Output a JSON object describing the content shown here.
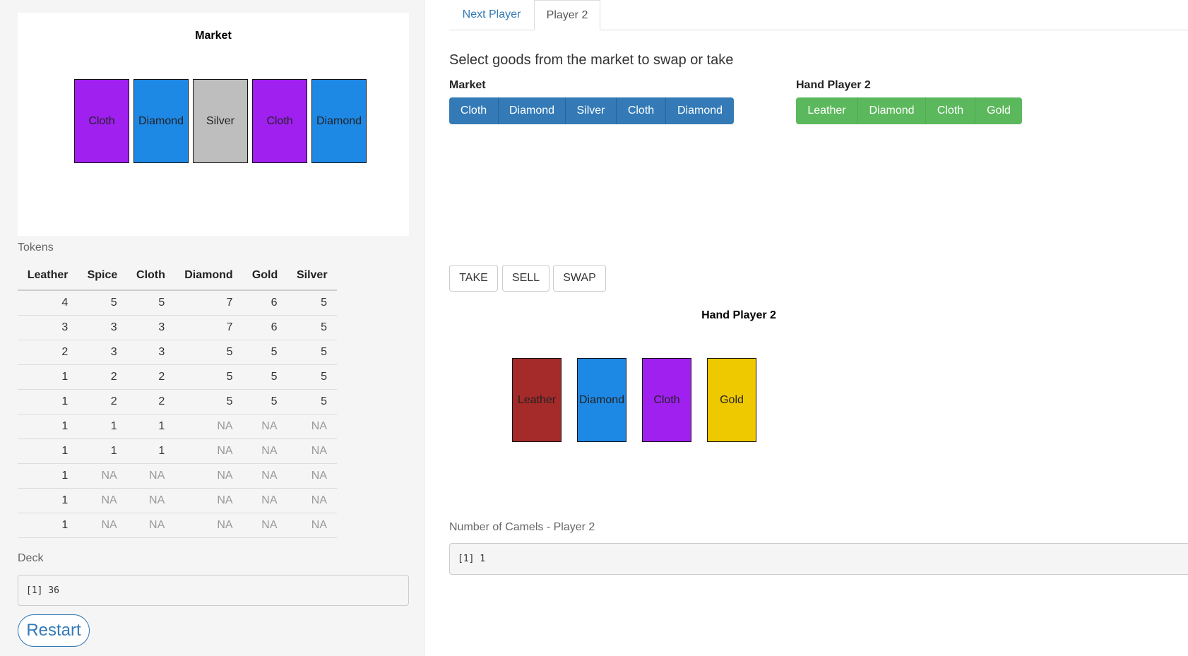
{
  "sidebar": {
    "market_plot": {
      "title": "Market",
      "cards": [
        {
          "label": "Cloth",
          "color": "#a020f0"
        },
        {
          "label": "Diamond",
          "color": "#1e88e5"
        },
        {
          "label": "Silver",
          "color": "#bebebe"
        },
        {
          "label": "Cloth",
          "color": "#a020f0"
        },
        {
          "label": "Diamond",
          "color": "#1e88e5"
        }
      ]
    },
    "tokens_label": "Tokens",
    "tokens_table": {
      "headers": [
        "Leather",
        "Spice",
        "Cloth",
        "Diamond",
        "Gold",
        "Silver"
      ],
      "rows": [
        [
          "4",
          "5",
          "5",
          "7",
          "6",
          "5"
        ],
        [
          "3",
          "3",
          "3",
          "7",
          "6",
          "5"
        ],
        [
          "2",
          "3",
          "3",
          "5",
          "5",
          "5"
        ],
        [
          "1",
          "2",
          "2",
          "5",
          "5",
          "5"
        ],
        [
          "1",
          "2",
          "2",
          "5",
          "5",
          "5"
        ],
        [
          "1",
          "1",
          "1",
          "NA",
          "NA",
          "NA"
        ],
        [
          "1",
          "1",
          "1",
          "NA",
          "NA",
          "NA"
        ],
        [
          "1",
          "NA",
          "NA",
          "NA",
          "NA",
          "NA"
        ],
        [
          "1",
          "NA",
          "NA",
          "NA",
          "NA",
          "NA"
        ],
        [
          "1",
          "NA",
          "NA",
          "NA",
          "NA",
          "NA"
        ]
      ]
    },
    "deck_label": "Deck",
    "deck_value": "[1] 36",
    "restart_label": "Restart"
  },
  "tabs": [
    {
      "label": "Next Player",
      "active": false
    },
    {
      "label": "Player 2",
      "active": true
    }
  ],
  "main": {
    "heading": "Select goods from the market to swap or take",
    "market_group_label": "Market",
    "market_buttons": [
      "Cloth",
      "Diamond",
      "Silver",
      "Cloth",
      "Diamond"
    ],
    "hand_group_label": "Hand Player 2",
    "hand_buttons": [
      "Leather",
      "Diamond",
      "Cloth",
      "Gold"
    ],
    "actions": {
      "take": "TAKE",
      "sell": "SELL",
      "swap": "SWAP"
    },
    "hand_plot": {
      "title": "Hand Player 2",
      "cards": [
        {
          "label": "Leather",
          "color": "#a52a2a"
        },
        {
          "label": "Diamond",
          "color": "#1e88e5"
        },
        {
          "label": "Cloth",
          "color": "#a020f0"
        },
        {
          "label": "Gold",
          "color": "#eec900"
        }
      ]
    },
    "camels_label": "Number of Camels - Player 2",
    "camels_value": "[1] 1"
  },
  "colors": {
    "primary": "#337ab7",
    "success": "#5cb85c",
    "sidebar_bg": "#f5f5f5"
  }
}
